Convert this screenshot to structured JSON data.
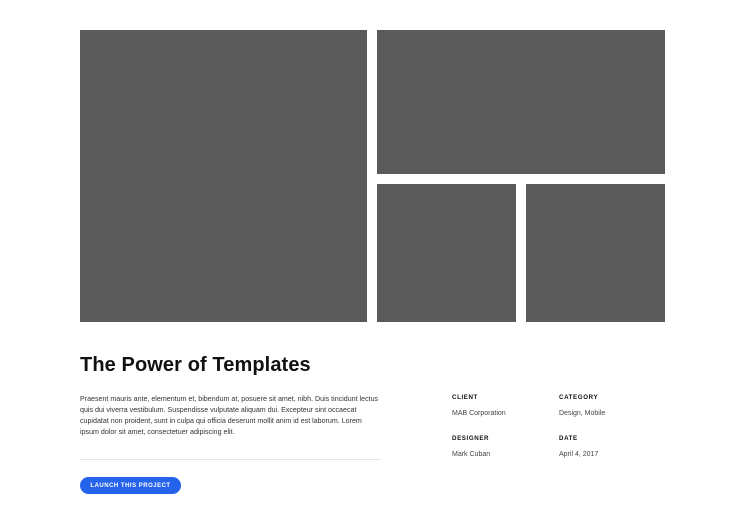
{
  "project": {
    "title": "The Power of Templates",
    "description": "Praesent mauris ante, elementum et, bibendum at, posuere sit amet, nibh. Duis tincidunt lectus quis dui viverra vestibulum. Suspendisse vulputate aliquam dui. Excepteur sint occaecat cupidatat non proident, sunt in culpa qui officia deserunt mollit anim id est laborum. Lorem ipsum dolor sit amet, consectetuer adipiscing elit.",
    "cta_label": "Launch This Project"
  },
  "meta": {
    "client": {
      "label": "CLIENT",
      "value": "MAB Corporation"
    },
    "category": {
      "label": "CATEGORY",
      "value": "Design, Mobile"
    },
    "designer": {
      "label": "DESIGNER",
      "value": "Mark Cuban"
    },
    "date": {
      "label": "DATE",
      "value": "April 4, 2017"
    }
  },
  "colors": {
    "image_placeholder": "#5a5a5a",
    "accent": "#2563eb"
  }
}
